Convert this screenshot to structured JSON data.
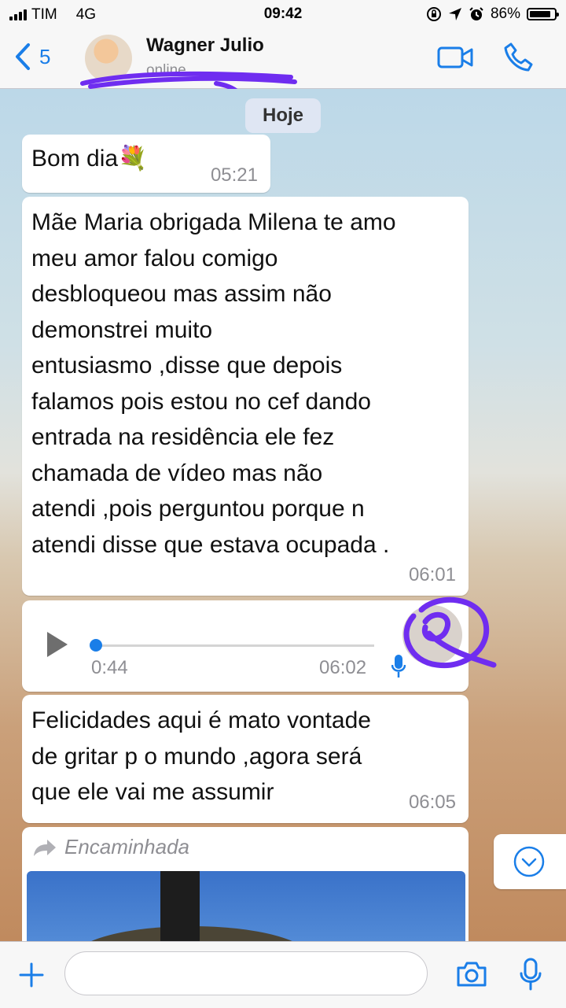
{
  "status_bar": {
    "carrier": "TIM",
    "network": "4G",
    "time": "09:42",
    "battery": "86%",
    "battery_level": 0.86
  },
  "header": {
    "back_count": "5",
    "contact_name": "Wagner Julio",
    "contact_status": "online"
  },
  "date_separator": "Hoje",
  "messages": [
    {
      "type": "text",
      "text": "Bom dia💐",
      "time": "05:21"
    },
    {
      "type": "text",
      "text": "Mãe Maria obrigada Milena te amo\nmeu amor falou comigo\ndesbloqueou mas assim não\ndemonstrei muito\nentusiasmo ,disse que depois\nfalamos pois estou no cef dando\nentrada na residência ele fez\nchamada de vídeo mas não\natendi ,pois perguntou porque n\natendi disse que estava ocupada .",
      "time": "06:01"
    },
    {
      "type": "audio",
      "duration": "0:44",
      "time": "06:02",
      "progress": 0
    },
    {
      "type": "text",
      "text": "Felicidades aqui é mato vontade\nde gritar p o mundo ,agora será\nque ele vai me assumir",
      "time": "06:05"
    },
    {
      "type": "forwarded",
      "label": "Encaminhada"
    }
  ],
  "icons": {
    "accent": "#1a7ee8",
    "scribble": "#7b3ff2"
  }
}
